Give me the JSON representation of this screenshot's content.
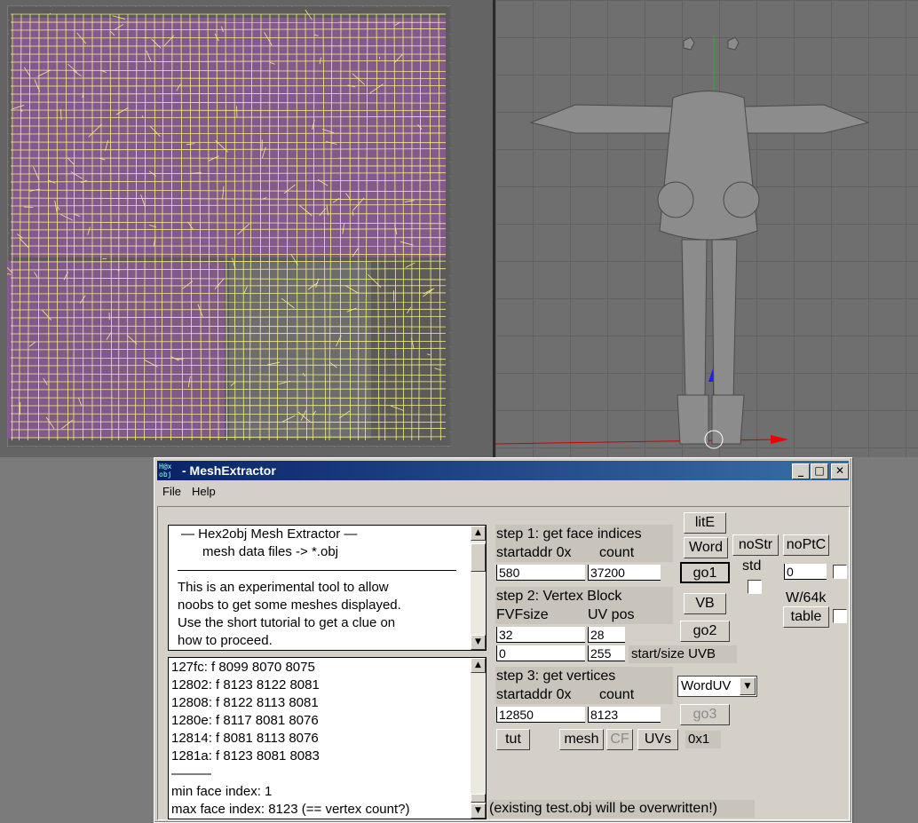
{
  "window": {
    "title": "- MeshExtractor",
    "icon_text": "H@x obj"
  },
  "title_buttons": {
    "minimize": "_",
    "maximize": "□",
    "close": "✕"
  },
  "menu": {
    "file": "File",
    "help": "Help"
  },
  "intro": {
    "line1": "— Hex2obj Mesh Extractor —",
    "line2": "mesh data files -> *.obj",
    "line3": "This is an experimental tool to allow",
    "line4": "noobs to get some meshes displayed.",
    "line5": "Use the short tutorial to get a clue on",
    "line6": "how to proceed."
  },
  "log": {
    "lines": [
      "127fc: f  8099 8070 8075",
      "12802: f  8123 8122 8081",
      "12808: f  8122 8113 8081",
      "1280e: f  8117 8081 8076",
      "12814: f  8081 8113 8076",
      "1281a: f  8123 8081 8083"
    ],
    "separator": "———",
    "min": "min face index: 1",
    "max": "max face index: 8123 (== vertex count?)"
  },
  "step1": {
    "title": "step 1: get face indices",
    "startaddr_label": "startaddr 0x",
    "count_label": "count",
    "startaddr": "580",
    "count": "37200"
  },
  "step2": {
    "title": "step 2: Vertex Block",
    "fvf_label": "FVFsize",
    "uvpos_label": "UV pos",
    "fvf": "32",
    "uvpos": "28",
    "start": "0",
    "size": "255",
    "startsize_label": "start/size UVB"
  },
  "step3": {
    "title": "step 3: get vertices",
    "startaddr_label": "startaddr 0x",
    "count_label": "count",
    "startaddr": "12850",
    "count": "8123"
  },
  "buttons": {
    "lite": "litE",
    "word": "Word",
    "go1": "go1",
    "vb": "VB",
    "go2": "go2",
    "go3": "go3",
    "nostr": "noStr",
    "std": "std",
    "noptc": "noPtC",
    "w64k": "W/64k",
    "table": "table",
    "tut": "tut",
    "mesh": "mesh",
    "cf": "CF",
    "uvs": "UVs"
  },
  "fields": {
    "ptc_value": "0",
    "hex_value": "0x1"
  },
  "dropdown": {
    "selected": "WordUV"
  },
  "status": "(existing test.obj will be overwritten!)",
  "colors": {
    "title_bar": "#0a246a",
    "wireframe": "#f5ef8a",
    "uv_fill": "#8b5a96"
  }
}
